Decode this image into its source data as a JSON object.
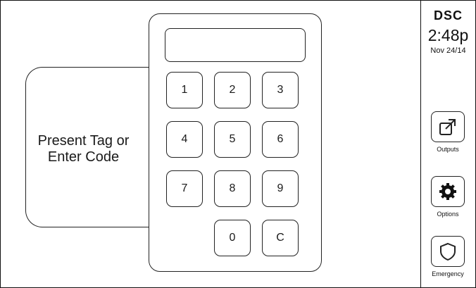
{
  "prompt": {
    "text": "Present Tag or\nEnter Code"
  },
  "display": {
    "code_value": ""
  },
  "keypad": {
    "keys": [
      "1",
      "2",
      "3",
      "4",
      "5",
      "6",
      "7",
      "8",
      "9",
      "0",
      "C"
    ]
  },
  "sidebar": {
    "brand": "DSC",
    "time": "2:48p",
    "date": "Nov 24/14",
    "buttons": [
      {
        "label": "Outputs",
        "icon": "external-link-icon"
      },
      {
        "label": "Options",
        "icon": "gear-icon"
      },
      {
        "label": "Emergency",
        "icon": "shield-icon"
      }
    ]
  }
}
